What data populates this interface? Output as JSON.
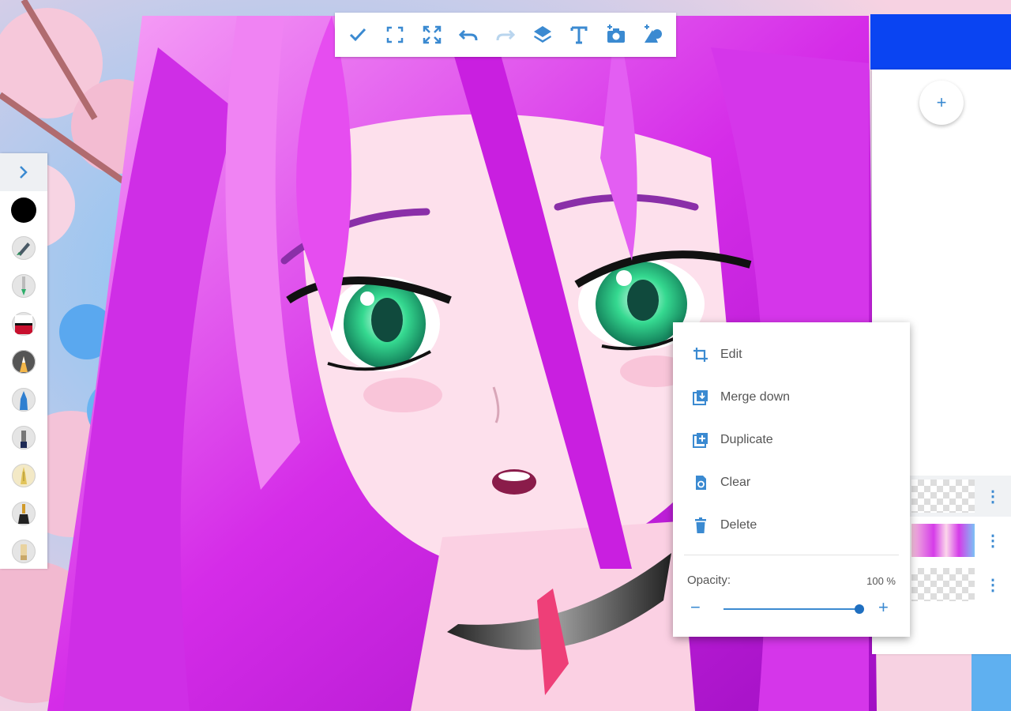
{
  "toolbar": {
    "icons": [
      "check-icon",
      "select-icon",
      "fullscreen-icon",
      "undo-icon",
      "redo-icon",
      "layers-icon",
      "text-icon",
      "camera-icon",
      "shapes-icon"
    ]
  },
  "tools": {
    "current_color": "#000000",
    "brushes": [
      "pen-icon",
      "marker-icon",
      "paint-brush-icon",
      "airbrush-icon",
      "crayon-icon",
      "ink-pen-icon",
      "calligraphy-icon",
      "flat-brush-icon",
      "eraser-icon"
    ]
  },
  "layers": {
    "add_icon": "+",
    "more_icon": "⋮",
    "accent": "#0a44f2"
  },
  "context_menu": {
    "edit": "Edit",
    "merge_down": "Merge down",
    "duplicate": "Duplicate",
    "clear": "Clear",
    "delete": "Delete",
    "opacity_label": "Opacity:",
    "opacity_value": "100 %",
    "opacity": 1.0,
    "minus": "−",
    "plus": "+"
  },
  "colors": {
    "ui_accent": "#3b8ad1",
    "hair": "#d426e8",
    "eyes": "#25c777"
  }
}
